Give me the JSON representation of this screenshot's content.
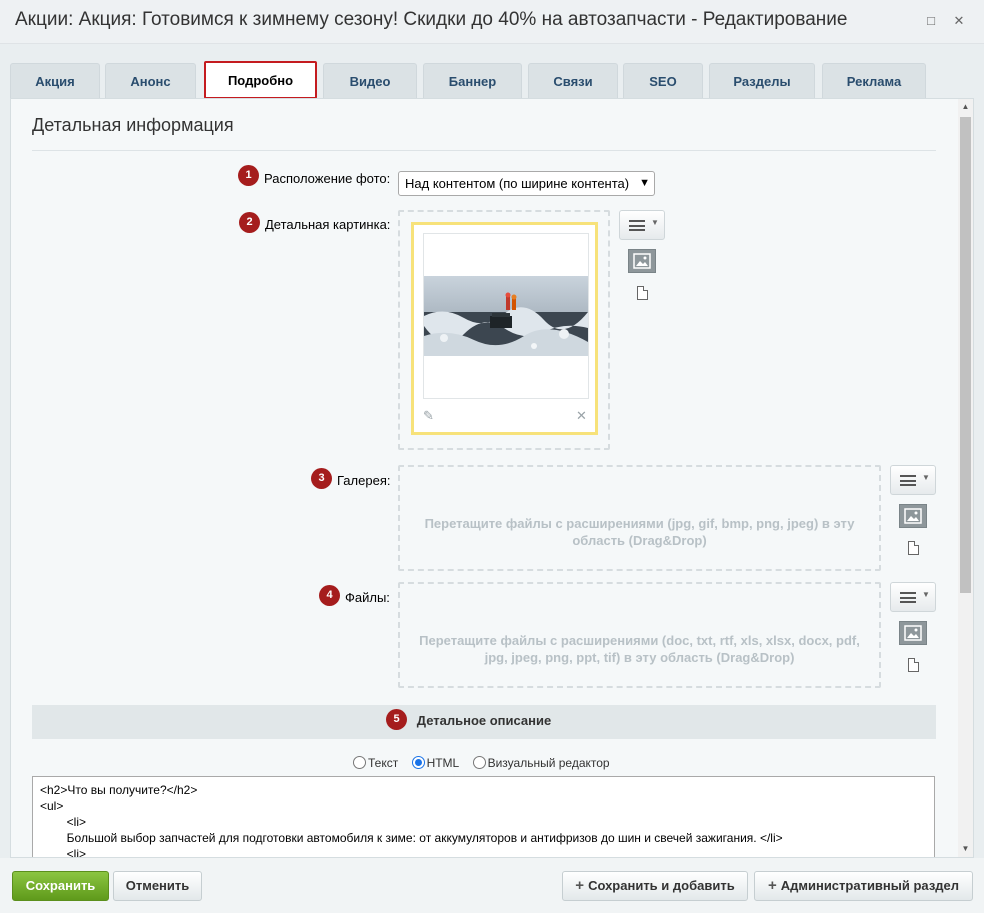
{
  "window": {
    "title": "Акции: Акция: Готовимся к зимнему сезону! Скидки до 40% на автозапчасти - Редактирование",
    "maximize_glyph": "□",
    "close_glyph": "✕"
  },
  "tabs": [
    {
      "label": "Акция",
      "active": false
    },
    {
      "label": "Анонс",
      "active": false
    },
    {
      "label": "Подробно",
      "active": true
    },
    {
      "label": "Видео",
      "active": false
    },
    {
      "label": "Баннер",
      "active": false
    },
    {
      "label": "Связи",
      "active": false
    },
    {
      "label": "SEO",
      "active": false
    },
    {
      "label": "Разделы",
      "active": false
    },
    {
      "label": "Реклама",
      "active": false
    }
  ],
  "section": {
    "title": "Детальная информация"
  },
  "fields": {
    "photo_position": {
      "badge": "1",
      "label": "Расположение фото:",
      "value": "Над контентом (по ширине контента)"
    },
    "detail_image": {
      "badge": "2",
      "label": "Детальная картинка:"
    },
    "gallery": {
      "badge": "3",
      "label": "Галерея:",
      "dropzone_text": "Перетащите файлы с расширениями (jpg, gif, bmp, png, jpeg) в эту область (Drag&Drop)"
    },
    "files": {
      "badge": "4",
      "label": "Файлы:",
      "dropzone_text": "Перетащите файлы с расширениями (doc, txt, rtf, xls, xlsx, docx, pdf, jpg, jpeg, png, ppt, tif) в эту область (Drag&Drop)"
    }
  },
  "description": {
    "badge": "5",
    "title": "Детальное описание",
    "modes": [
      {
        "label": "Текст",
        "checked": false
      },
      {
        "label": "HTML",
        "checked": true
      },
      {
        "label": "Визуальный редактор",
        "checked": false
      }
    ],
    "content": "<h2>Что вы получите?</h2>\n<ul>\n        <li>\n        Большой выбор запчастей для подготовки автомобиля к зиме: от аккумуляторов и антифризов до шин и свечей зажигания. </li>\n        <li>"
  },
  "footer": {
    "save": "Сохранить",
    "cancel": "Отменить",
    "save_add": "Сохранить и добавить",
    "admin_section": "Административный раздел"
  },
  "icons": {
    "menu": "menu-icon",
    "image": "image-icon",
    "file": "file-icon",
    "edit": "pencil-icon",
    "remove": "close-icon"
  },
  "colors": {
    "badge": "#a51d1d",
    "active_tab_border": "#c41b1f",
    "primary_button": "#6aa726",
    "image_card_border": "#f7e27a"
  }
}
